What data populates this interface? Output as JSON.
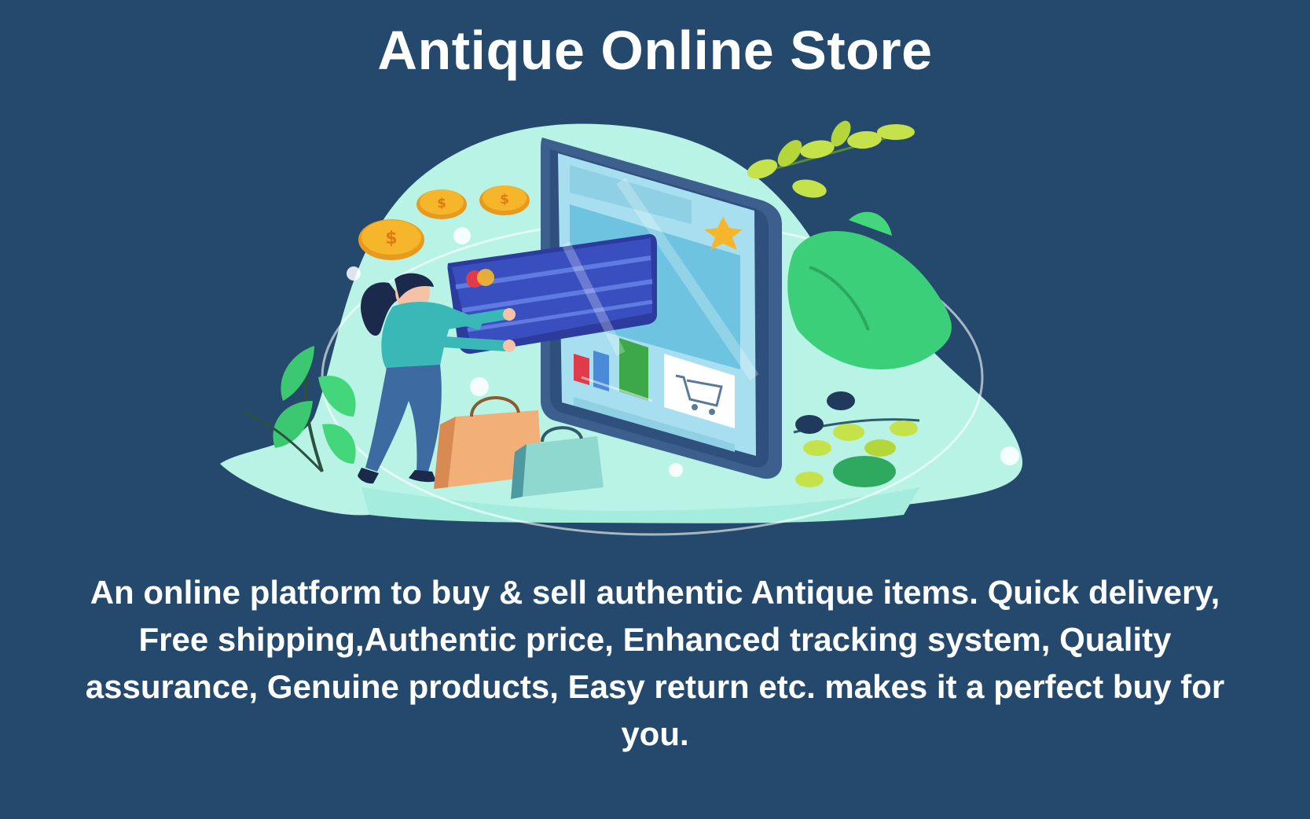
{
  "header": {
    "title": "Antique Online Store"
  },
  "illustration": {
    "icons": [
      "coin-icon",
      "credit-card-icon",
      "tablet-icon",
      "shopping-bag-icon",
      "cart-icon",
      "star-icon",
      "leaf-icon",
      "woman-figure"
    ],
    "colors": {
      "background": "#24496d",
      "blob": "#b8f3e6",
      "card": "#3a4fbf",
      "coin": "#f6b62c",
      "leaf_light": "#c6e24a",
      "leaf_green": "#3ccf7a",
      "tablet_frame": "#3d5f8e",
      "bag": "#f2b078"
    }
  },
  "main": {
    "description": "An online platform to buy & sell authentic Antique items. Quick delivery, Free shipping,Authentic price, Enhanced tracking system, Quality assurance, Genuine products, Easy return etc. makes it a perfect buy for you."
  }
}
